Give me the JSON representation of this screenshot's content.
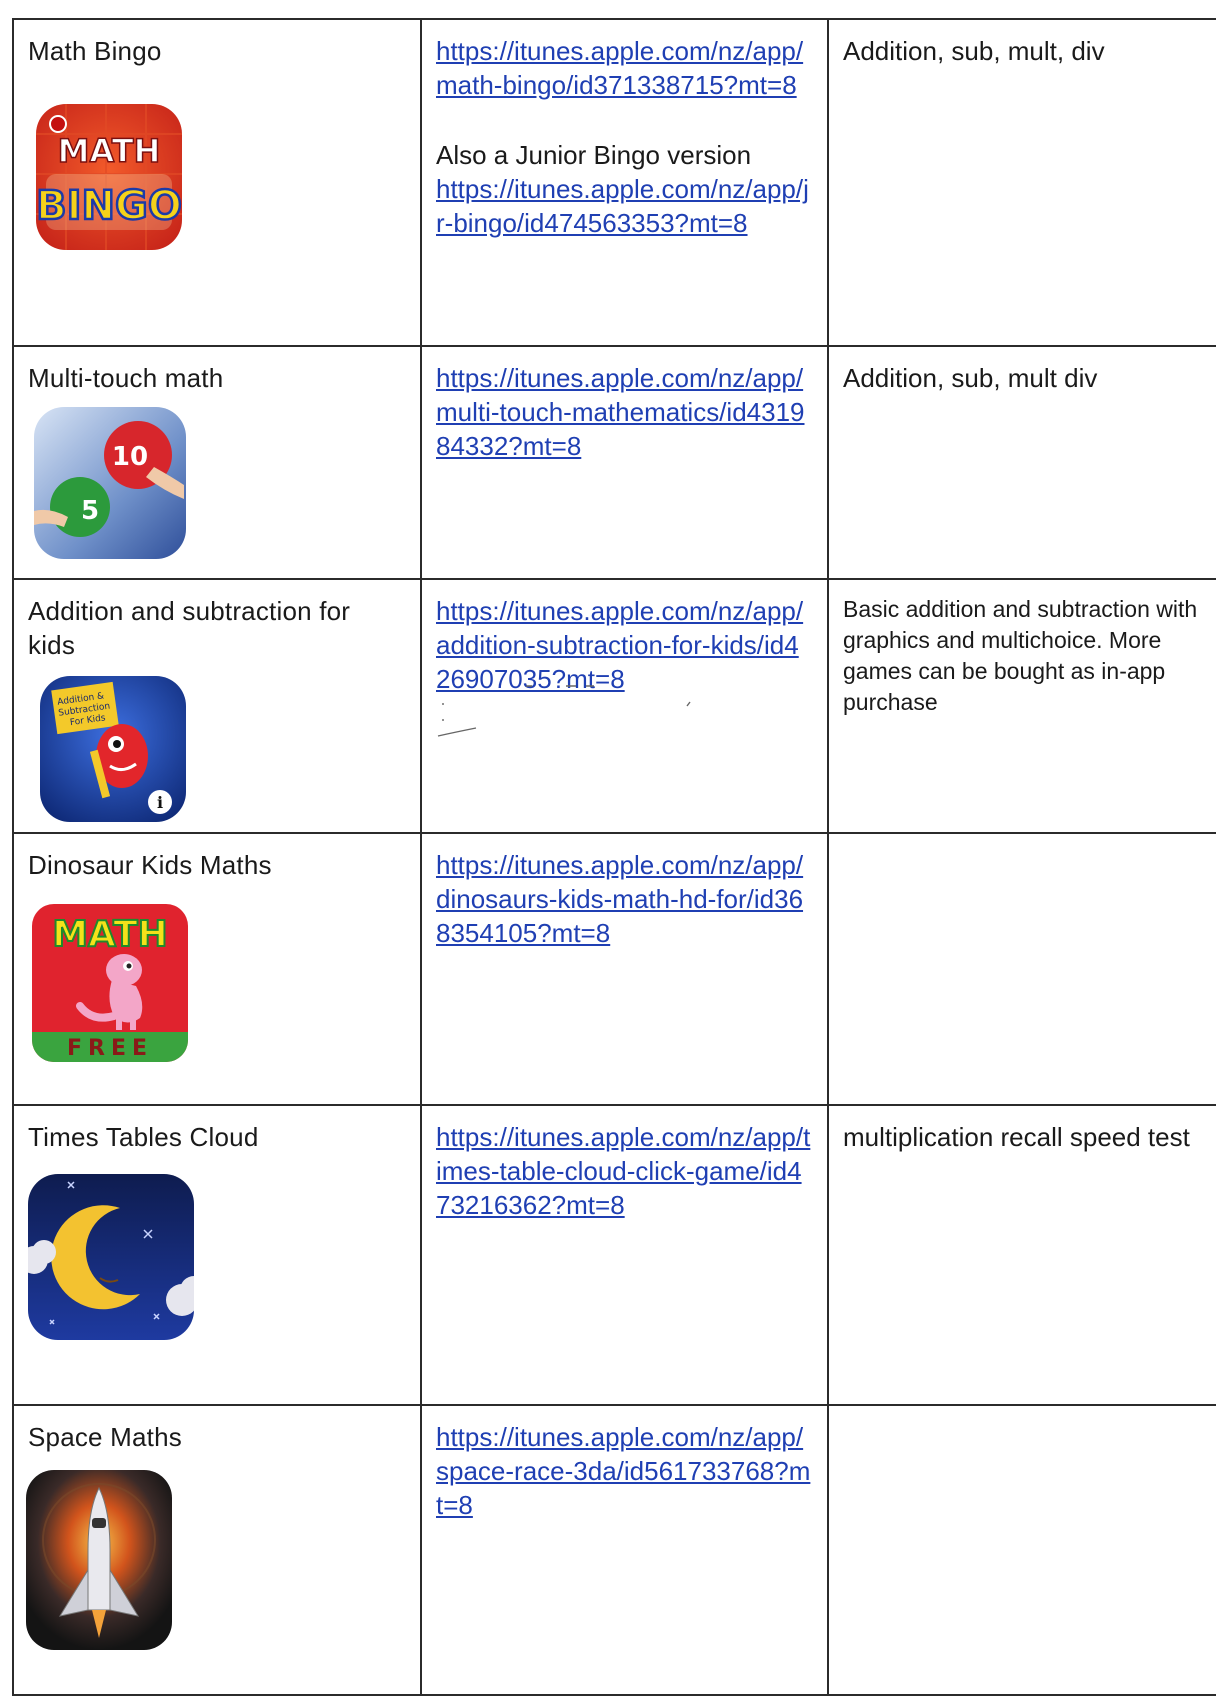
{
  "rows": [
    {
      "name": "Math Bingo",
      "icon": "math-bingo-icon",
      "icon_text": [
        "MATH",
        "BINGO"
      ],
      "links": [
        "https://itunes.apple.com/nz/app/math-bingo/id371338715?mt=8"
      ],
      "extra_text": "Also a Junior Bingo version",
      "extra_link": "https://itunes.apple.com/nz/app/jr-bingo/id474563353?mt=8",
      "notes": "Addition, sub, mult, div"
    },
    {
      "name": "Multi-touch math",
      "icon": "multi-touch-math-icon",
      "icon_text": [
        "10",
        "5"
      ],
      "links": [
        "https://itunes.apple.com/nz/app/multi-touch-mathematics/id431984332?mt=8"
      ],
      "notes": "Addition, sub, mult div"
    },
    {
      "name": "Addition and subtraction for kids",
      "icon": "addition-subtraction-kids-icon",
      "icon_text": [
        "Addition &",
        "Subtraction",
        "For Kids"
      ],
      "links": [
        "https://itunes.apple.com/nz/app/addition-subtraction-for-kids/id426907035?mt=8"
      ],
      "notes": "Basic addition and subtraction with graphics and multichoice. More games can be bought as in-app purchase"
    },
    {
      "name": "Dinosaur Kids Maths",
      "icon": "dinosaur-math-icon",
      "icon_text": [
        "MATH",
        "FREE"
      ],
      "links": [
        "https://itunes.apple.com/nz/app/dinosaurs-kids-math-hd-for/id368354105?mt=8"
      ],
      "notes": ""
    },
    {
      "name": "Times Tables Cloud",
      "icon": "moon-cloud-icon",
      "links": [
        "https://itunes.apple.com/nz/app/times-table-cloud-click-game/id473216362?mt=8"
      ],
      "notes": "multiplication recall speed test"
    },
    {
      "name": "Space Maths",
      "icon": "space-shuttle-icon",
      "links": [
        "https://itunes.apple.com/nz/app/space-race-3da/id561733768?mt=8"
      ],
      "notes": ""
    }
  ],
  "colors": {
    "link": "#1f3fb3",
    "border": "#2b2b2b",
    "text": "#1a1a1a"
  }
}
